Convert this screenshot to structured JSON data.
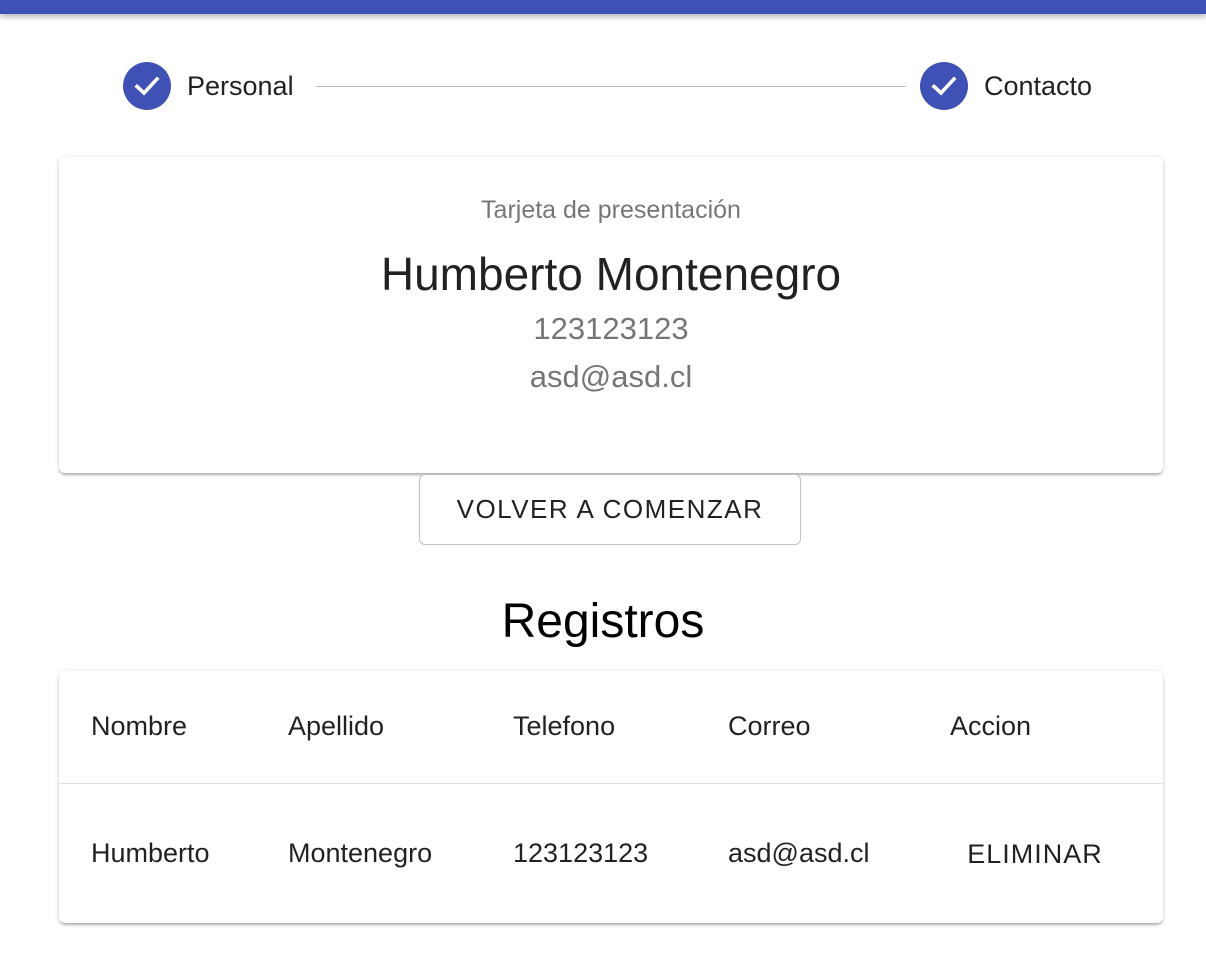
{
  "stepper": {
    "steps": [
      {
        "label": "Personal",
        "icon": "check-icon",
        "status": "completed"
      },
      {
        "label": "Contacto",
        "icon": "check-icon",
        "status": "completed"
      }
    ]
  },
  "card": {
    "subtitle": "Tarjeta de presentación",
    "name": "Humberto Montenegro",
    "phone": "123123123",
    "email": "asd@asd.cl"
  },
  "reset_button_label": "VOLVER A COMENZAR",
  "records": {
    "title": "Registros",
    "columns": [
      "Nombre",
      "Apellido",
      "Telefono",
      "Correo",
      "Accion"
    ],
    "rows": [
      {
        "nombre": "Humberto",
        "apellido": "Montenegro",
        "telefono": "123123123",
        "correo": "asd@asd.cl",
        "action_label": "ELIMINAR"
      }
    ]
  },
  "colors": {
    "primary": "#3f51b5",
    "connector": "#bdbdbd"
  }
}
